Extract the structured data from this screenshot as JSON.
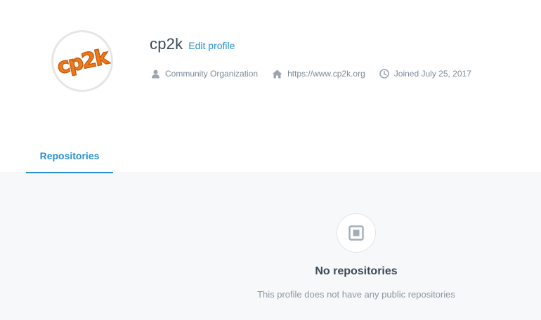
{
  "profile": {
    "name": "cp2k",
    "edit_label": "Edit profile",
    "avatar_text": "cp2k",
    "type": "Community Organization",
    "website": "https://www.cp2k.org",
    "joined": "Joined July 25, 2017"
  },
  "tabs": [
    {
      "label": "Repositories",
      "active": true
    }
  ],
  "empty_state": {
    "title": "No repositories",
    "subtitle": "This profile does not have any public repositories"
  },
  "colors": {
    "accent": "#2a8fd0",
    "logo_orange": "#f07a1a"
  },
  "icons": {
    "type": "person-icon",
    "website": "home-icon",
    "joined": "clock-icon",
    "empty": "repository-icon"
  }
}
